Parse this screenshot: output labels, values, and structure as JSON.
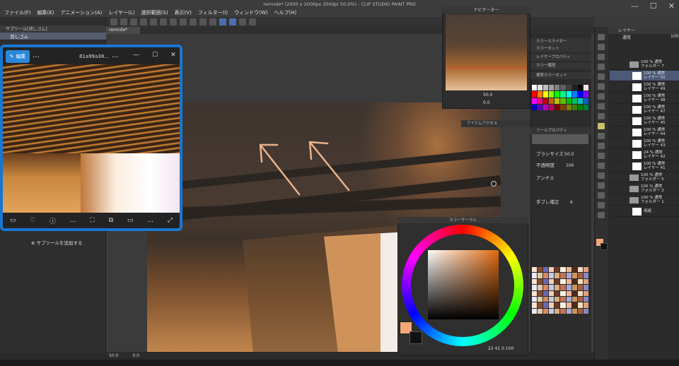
{
  "app": {
    "title": "remnde* (2000 x 2000px 300dpi 50.0%) - CLIP STUDIO PAINT PRO",
    "menu": [
      "ファイル(F)",
      "編集(E)",
      "アニメーション(A)",
      "レイヤー(L)",
      "選択範囲(S)",
      "表示(V)",
      "フィルター(I)",
      "ウィンドウ(W)",
      "ヘルプ(H)"
    ],
    "canvas_tab": "remnde*"
  },
  "sub_tool": {
    "tab": "サブツール[消しゴム]",
    "selected_item": "消しゴム",
    "add_button": "サブツールを追加する"
  },
  "viewer": {
    "edit_label": "編集",
    "filename": "81a99a38...",
    "more": "...",
    "controls": [
      "—",
      "☐",
      "✕"
    ],
    "bottom_icons": [
      "▭",
      "♡",
      "ⓘ",
      "…",
      "⛶",
      "⧉",
      "▭",
      "…",
      "⤢"
    ]
  },
  "navigator": {
    "title": "ナビゲーター",
    "zoom": "50.0",
    "angle": "0.0"
  },
  "mid_panels": {
    "headers": [
      "カラースライダー",
      "カラーセット",
      "レイヤープロパティ",
      "カラー履歴",
      "アイテムアクセス",
      "ツールプロパティ"
    ],
    "color_set_name": "標準カラーセット",
    "brush_size_label": "ブラシサイズ",
    "brush_size_value": "50.0",
    "opacity_label": "不透明度",
    "opacity_value": "100",
    "aa_label": "アンチエ",
    "stabilization_label": "手ブレ補正",
    "stabilization_value": "6"
  },
  "color_wheel": {
    "title": "カラーサークル",
    "info": "22  41  0  100"
  },
  "canvas_status": {
    "zoom": "50.0",
    "angle": "0.0"
  },
  "layers": {
    "title": "レイヤー",
    "blend": "通常",
    "opacity": "100",
    "rows": [
      {
        "label": "100 % 通常\nフォルダー 7",
        "type": "folder"
      },
      {
        "label": "100 % 通常\nレイヤー 50",
        "type": "layer",
        "selected": true
      },
      {
        "label": "100 % 通常\nレイヤー 49",
        "type": "layer"
      },
      {
        "label": "100 % 通常\nレイヤー 48",
        "type": "layer"
      },
      {
        "label": "100 % 通常\nレイヤー 47",
        "type": "layer"
      },
      {
        "label": "100 % 通常\nレイヤー 45",
        "type": "layer"
      },
      {
        "label": "100 % 通常\nレイヤー 44",
        "type": "layer"
      },
      {
        "label": "100 % 通常\nレイヤー 43",
        "type": "layer"
      },
      {
        "label": "24 % 通常\nレイヤー 42",
        "type": "layer"
      },
      {
        "label": "100 % 通常\nレイヤー 41",
        "type": "layer"
      },
      {
        "label": "100 % 通常\nフォルダー 5",
        "type": "folder"
      },
      {
        "label": "100 % 通常\nフォルダー 2",
        "type": "folder"
      },
      {
        "label": "100 % 通常\nフォルダー 1",
        "type": "folder"
      },
      {
        "label": "用紙",
        "type": "paper"
      }
    ]
  },
  "colors": {
    "main": "#f3a878",
    "sub": "#111111",
    "accent": "#1976d2"
  }
}
